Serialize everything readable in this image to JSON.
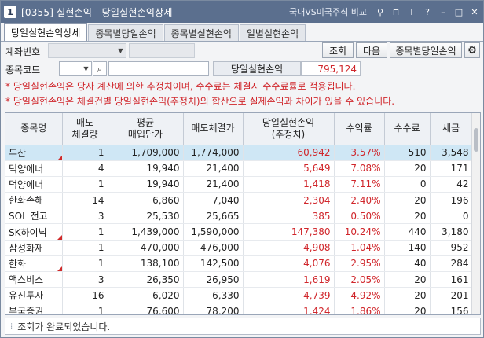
{
  "window": {
    "number": "1",
    "title": "[0355] 실현손익 - 당일실현손익상세",
    "compare_link": "국내VS미국주식 비교",
    "icons": [
      "link-icon",
      "help-icon",
      "text-size-icon",
      "help-question-icon",
      "minimize-icon",
      "maximize-icon",
      "close-icon"
    ],
    "glyphs": {
      "link": "⚲",
      "pin": "⊓",
      "text": "T",
      "help": "?",
      "min": "–",
      "max": "□",
      "close": "✕"
    }
  },
  "tabs": [
    "당일실현손익상세",
    "종목별당일손익",
    "종목별실현손익",
    "일별실현손익"
  ],
  "form": {
    "account_label": "계좌번호",
    "stock_code_label": "종목코드",
    "buttons": {
      "search": "조회",
      "next": "다음",
      "by_stock": "종목별당일손익"
    },
    "summary_label": "당일실현손익",
    "summary_value": "795,124"
  },
  "notes": [
    "* 당일실현손익은 당사 계산에 의한 추정치이며, 수수료는 체결시 수수료률로 적용됩니다.",
    "* 당일실현손익은 체결건별 당일실현손익(추정치)의 합산으로 실제손익과 차이가 있을 수 있습니다."
  ],
  "table": {
    "headers": [
      "종목명",
      "매도\n체결량",
      "평균\n매입단가",
      "매도체결가",
      "당일실현손익\n(추정치)",
      "수익률",
      "수수료",
      "세금"
    ],
    "rows": [
      [
        "두산",
        "1",
        "1,709,000",
        "1,774,000",
        "60,942",
        "3.57%",
        "510",
        "3,548"
      ],
      [
        "덕양에너",
        "4",
        "19,940",
        "21,400",
        "5,649",
        "7.08%",
        "20",
        "171"
      ],
      [
        "덕양에너",
        "1",
        "19,940",
        "21,400",
        "1,418",
        "7.11%",
        "0",
        "42"
      ],
      [
        "한화손해",
        "14",
        "6,860",
        "7,040",
        "2,304",
        "2.40%",
        "20",
        "196"
      ],
      [
        "SOL 전고",
        "3",
        "25,530",
        "25,665",
        "385",
        "0.50%",
        "20",
        "0"
      ],
      [
        "SK하이닉",
        "1",
        "1,439,000",
        "1,590,000",
        "147,380",
        "10.24%",
        "440",
        "3,180"
      ],
      [
        "삼성화재",
        "1",
        "470,000",
        "476,000",
        "4,908",
        "1.04%",
        "140",
        "952"
      ],
      [
        "한화",
        "1",
        "138,100",
        "142,500",
        "4,076",
        "2.95%",
        "40",
        "284"
      ],
      [
        "액스비스",
        "3",
        "26,350",
        "26,950",
        "1,619",
        "2.05%",
        "20",
        "161"
      ],
      [
        "유진투자",
        "16",
        "6,020",
        "6,330",
        "4,739",
        "4.92%",
        "20",
        "201"
      ],
      [
        "부국증권",
        "1",
        "76,600",
        "78,200",
        "1,424",
        "1.86%",
        "20",
        "156"
      ]
    ],
    "flag_rows": [
      0,
      5,
      7
    ],
    "selected_row": 0
  },
  "status": "조회가 완료되었습니다.",
  "colors": {
    "titlebar": "#5b6f8e",
    "profit": "#d0262b",
    "selected": "#cfe7f5"
  }
}
